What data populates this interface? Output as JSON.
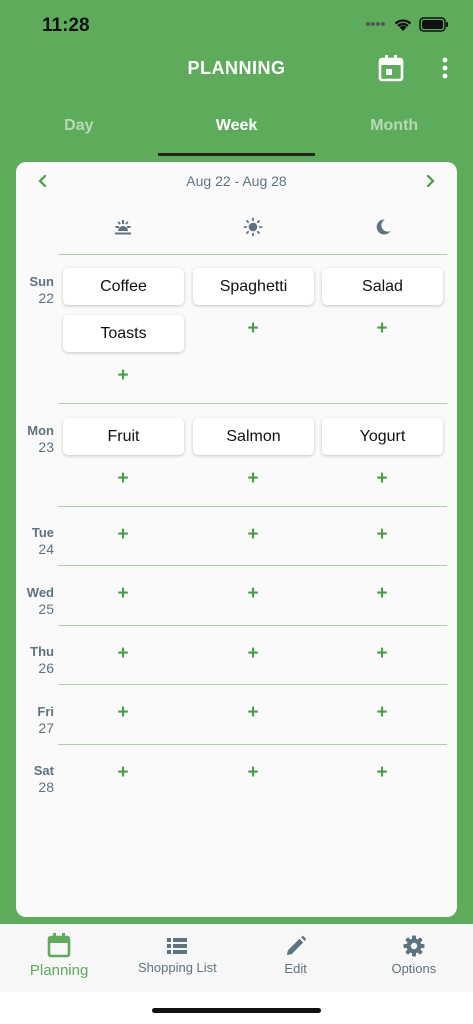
{
  "status": {
    "time": "11:28"
  },
  "header": {
    "title": "PLANNING"
  },
  "tabs": [
    {
      "label": "Day",
      "active": false
    },
    {
      "label": "Week",
      "active": true
    },
    {
      "label": "Month",
      "active": false
    }
  ],
  "week": {
    "range": "Aug 22 - Aug 28",
    "meal_icons": [
      "sunrise-icon",
      "sun-icon",
      "moon-icon"
    ],
    "days": [
      {
        "name": "Sun",
        "num": "22",
        "meals": [
          "Coffee",
          "Spaghetti",
          "Salad",
          "Toasts"
        ]
      },
      {
        "name": "Mon",
        "num": "23",
        "meals": [
          "Fruit",
          "Salmon",
          "Yogurt"
        ]
      },
      {
        "name": "Tue",
        "num": "24",
        "meals": []
      },
      {
        "name": "Wed",
        "num": "25",
        "meals": []
      },
      {
        "name": "Thu",
        "num": "26",
        "meals": []
      },
      {
        "name": "Fri",
        "num": "27",
        "meals": []
      },
      {
        "name": "Sat",
        "num": "28",
        "meals": []
      }
    ],
    "add_symbol": "+"
  },
  "bottom_nav": [
    {
      "label": "Planning",
      "icon": "calendar-icon",
      "active": true
    },
    {
      "label": "Shopping List",
      "icon": "list-icon",
      "active": false
    },
    {
      "label": "Edit",
      "icon": "pencil-icon",
      "active": false
    },
    {
      "label": "Options",
      "icon": "gear-icon",
      "active": false
    }
  ],
  "colors": {
    "primary": "#5fab5c",
    "accent": "#4a9c48",
    "muted": "#5d7380",
    "card": "#fafafa"
  }
}
